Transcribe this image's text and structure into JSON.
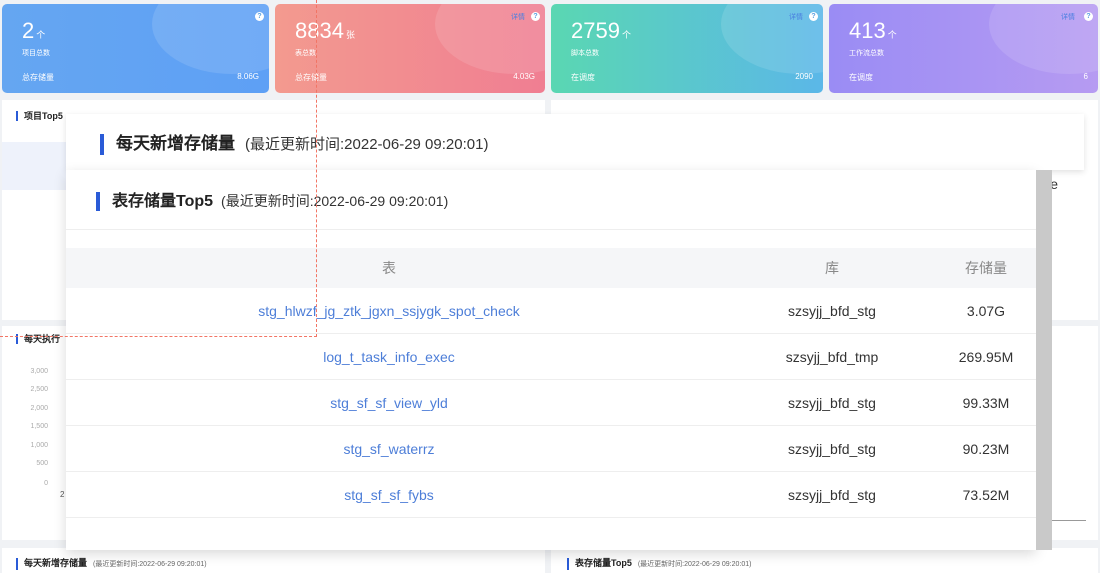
{
  "cards": [
    {
      "number": "2",
      "unit": "个",
      "label": "项目总数",
      "foot_label": "总存储量",
      "foot_value": "8.06G",
      "detail": ""
    },
    {
      "number": "8834",
      "unit": "张",
      "label": "表总数",
      "foot_label": "总存储量",
      "foot_value": "4.03G",
      "detail": "详情"
    },
    {
      "number": "2759",
      "unit": "个",
      "label": "脚本总数",
      "foot_label": "在调度",
      "foot_value": "2090",
      "detail": "详情"
    },
    {
      "number": "413",
      "unit": "个",
      "label": "工作流总数",
      "foot_label": "在调度",
      "foot_value": "6",
      "detail": "详情"
    }
  ],
  "help_glyph": "?",
  "colors": {
    "accent": "#2a5bd7",
    "link": "#4d7ed8"
  },
  "bg": {
    "project_top5_title": "项目Top5",
    "daily_exec_title": "每天执行",
    "y_axis": [
      "3,000",
      "2,500",
      "2,000",
      "1,500",
      "1,000",
      "500",
      "0"
    ],
    "x_first": "2",
    "right_edge_char": "e",
    "bottom_left_title": "每天新增存储量",
    "bottom_left_sub": "(最近更新时间:2022-06-29 09:20:01)",
    "bottom_right_title": "表存储量Top5",
    "bottom_right_sub": "(最近更新时间:2022-06-29 09:20:01)"
  },
  "overlay_daily": {
    "title": "每天新增存储量",
    "sub": "(最近更新时间:2022-06-29 09:20:01)"
  },
  "overlay_table": {
    "title": "表存储量Top5",
    "sub": "(最近更新时间:2022-06-29 09:20:01)",
    "headers": [
      "表",
      "库",
      "存储量"
    ],
    "rows": [
      [
        "stg_hlwzf_jg_ztk_jgxn_ssjygk_spot_check",
        "szsyjj_bfd_stg",
        "3.07G"
      ],
      [
        "log_t_task_info_exec",
        "szsyjj_bfd_tmp",
        "269.95M"
      ],
      [
        "stg_sf_sf_view_yld",
        "szsyjj_bfd_stg",
        "99.33M"
      ],
      [
        "stg_sf_waterrz",
        "szsyjj_bfd_stg",
        "90.23M"
      ],
      [
        "stg_sf_sf_fybs",
        "szsyjj_bfd_stg",
        "73.52M"
      ]
    ]
  }
}
